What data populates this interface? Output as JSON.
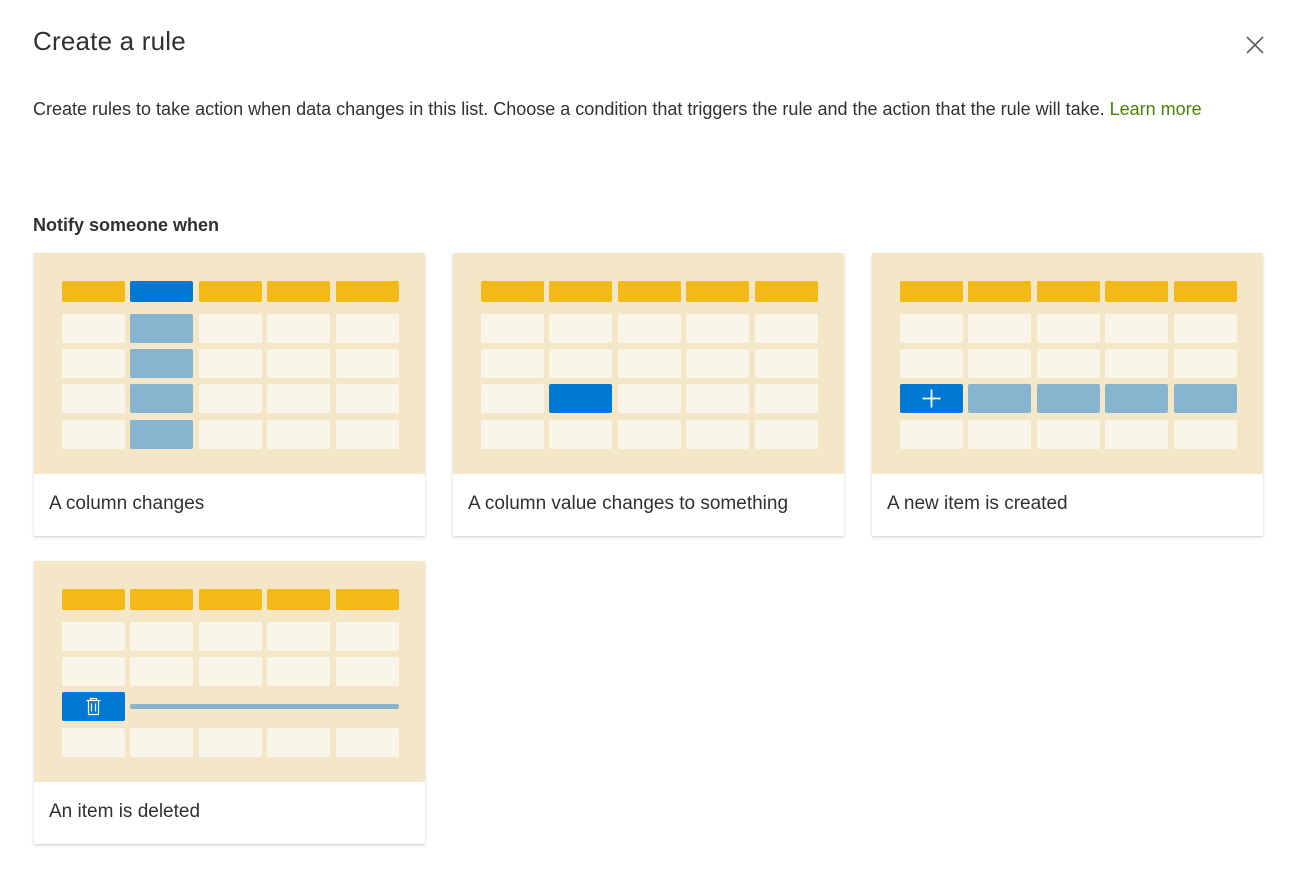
{
  "dialog": {
    "title": "Create a rule",
    "description": "Create rules to take action when data changes in this list. Choose a condition that triggers the rule and the action that the rule will take.",
    "learn_more": "Learn more",
    "section_label": "Notify someone when"
  },
  "icons": {
    "close": "close-icon",
    "add": "plus-icon",
    "delete": "trash-icon"
  },
  "colors": {
    "header": "#f2b918",
    "cell": "#faf5e9",
    "selected": "#0078d4",
    "highlight": "#87b5cf",
    "link": "#498205",
    "card_bg": "#f4e7c8"
  },
  "cards": [
    {
      "label": "A column changes"
    },
    {
      "label": "A column value changes to something"
    },
    {
      "label": "A new item is created"
    },
    {
      "label": "An item is deleted"
    }
  ]
}
